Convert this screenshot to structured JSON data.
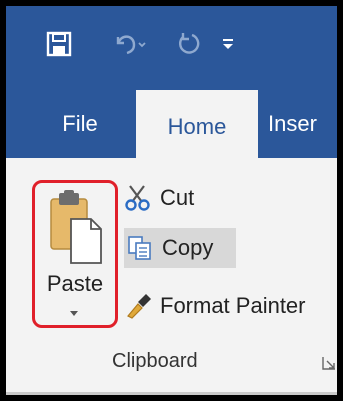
{
  "quick_access": {
    "save_icon": "save-icon",
    "undo_icon": "undo-icon",
    "redo_icon": "redo-icon",
    "customize_icon": "customize-qat-icon"
  },
  "tabs": [
    {
      "label": "File",
      "active": false
    },
    {
      "label": "Home",
      "active": true
    },
    {
      "label": "Inser",
      "active": false
    }
  ],
  "clipboard": {
    "paste_label": "Paste",
    "commands": [
      {
        "label": "Cut",
        "icon": "scissors-icon"
      },
      {
        "label": "Copy",
        "icon": "copy-icon"
      },
      {
        "label": "Format Painter",
        "icon": "format-painter-icon"
      }
    ],
    "group_label": "Clipboard"
  },
  "colors": {
    "ribbon_blue": "#2b579a",
    "ribbon_bg": "#f3f3f3",
    "highlight_red": "#e0202a"
  }
}
